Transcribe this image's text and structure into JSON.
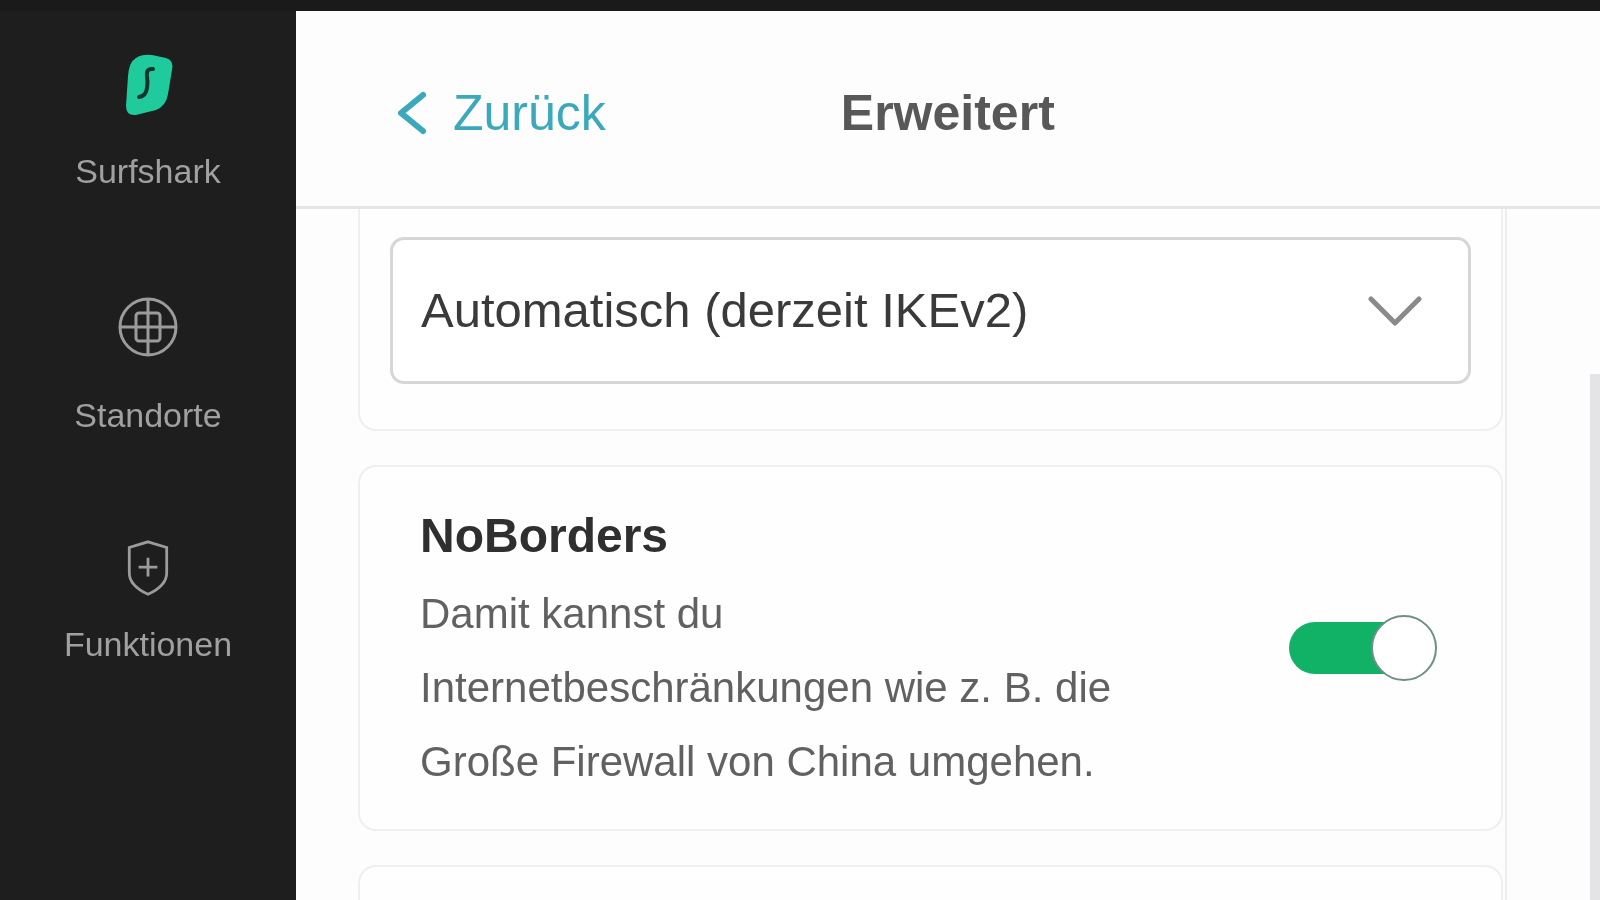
{
  "sidebar": {
    "brand": "Surfshark",
    "items": [
      {
        "label": "Standorte"
      },
      {
        "label": "Funktionen"
      }
    ]
  },
  "header": {
    "back": "Zurück",
    "title": "Erweitert"
  },
  "protocol": {
    "value": "Automatisch (derzeit IKEv2)"
  },
  "features": [
    {
      "title": "NoBorders",
      "description": "Damit kannst du Internetbeschränkungen wie z. B. die Große Firewall von China umgehen.",
      "on": true
    }
  ]
}
